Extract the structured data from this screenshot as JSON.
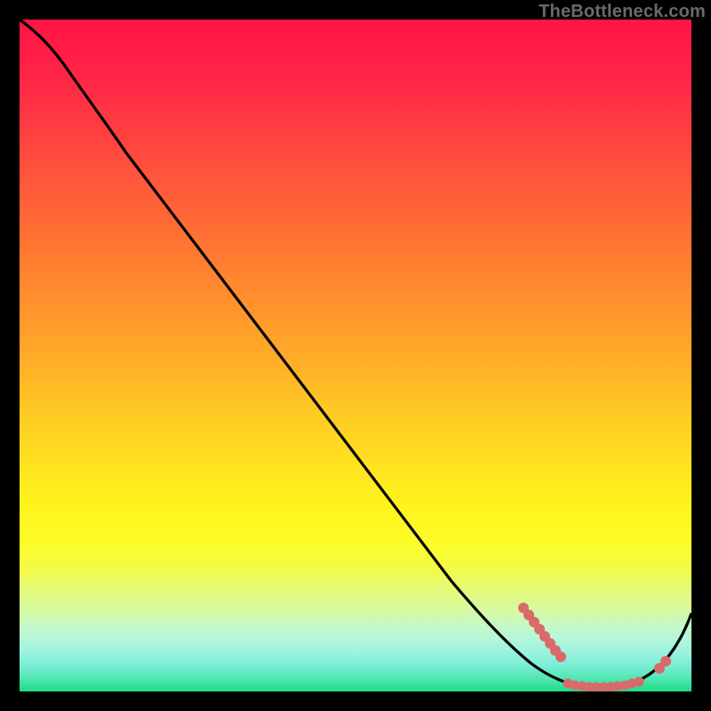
{
  "watermark": "TheBottleneck.com",
  "colors": {
    "dot": "#d96a6a",
    "curve": "#000000"
  },
  "chart_data": {
    "type": "line",
    "title": "",
    "xlabel": "",
    "ylabel": "",
    "xlim": [
      0,
      100
    ],
    "ylim": [
      0,
      100
    ],
    "grid": false,
    "series": [
      {
        "name": "curve",
        "x": [
          0,
          3,
          8,
          15,
          25,
          35,
          45,
          55,
          65,
          72,
          76,
          80,
          82,
          84,
          86,
          88,
          90,
          92,
          94,
          96,
          98,
          100
        ],
        "y": [
          100,
          97,
          93,
          86,
          74,
          62,
          50,
          38,
          26,
          16,
          10,
          5,
          3,
          1.8,
          1.0,
          0.6,
          0.4,
          0.4,
          0.6,
          1.8,
          4.5,
          9
        ]
      }
    ],
    "annotations": {
      "dots_cluster_left": {
        "x_range": [
          75,
          79
        ],
        "y_range": [
          6,
          12
        ]
      },
      "dots_row_bottom": {
        "x_range": [
          80,
          93
        ],
        "y_approx": 0.7
      },
      "dots_pair_right": {
        "x_range": [
          95,
          97
        ],
        "y_range": [
          1.5,
          3.5
        ]
      }
    }
  }
}
